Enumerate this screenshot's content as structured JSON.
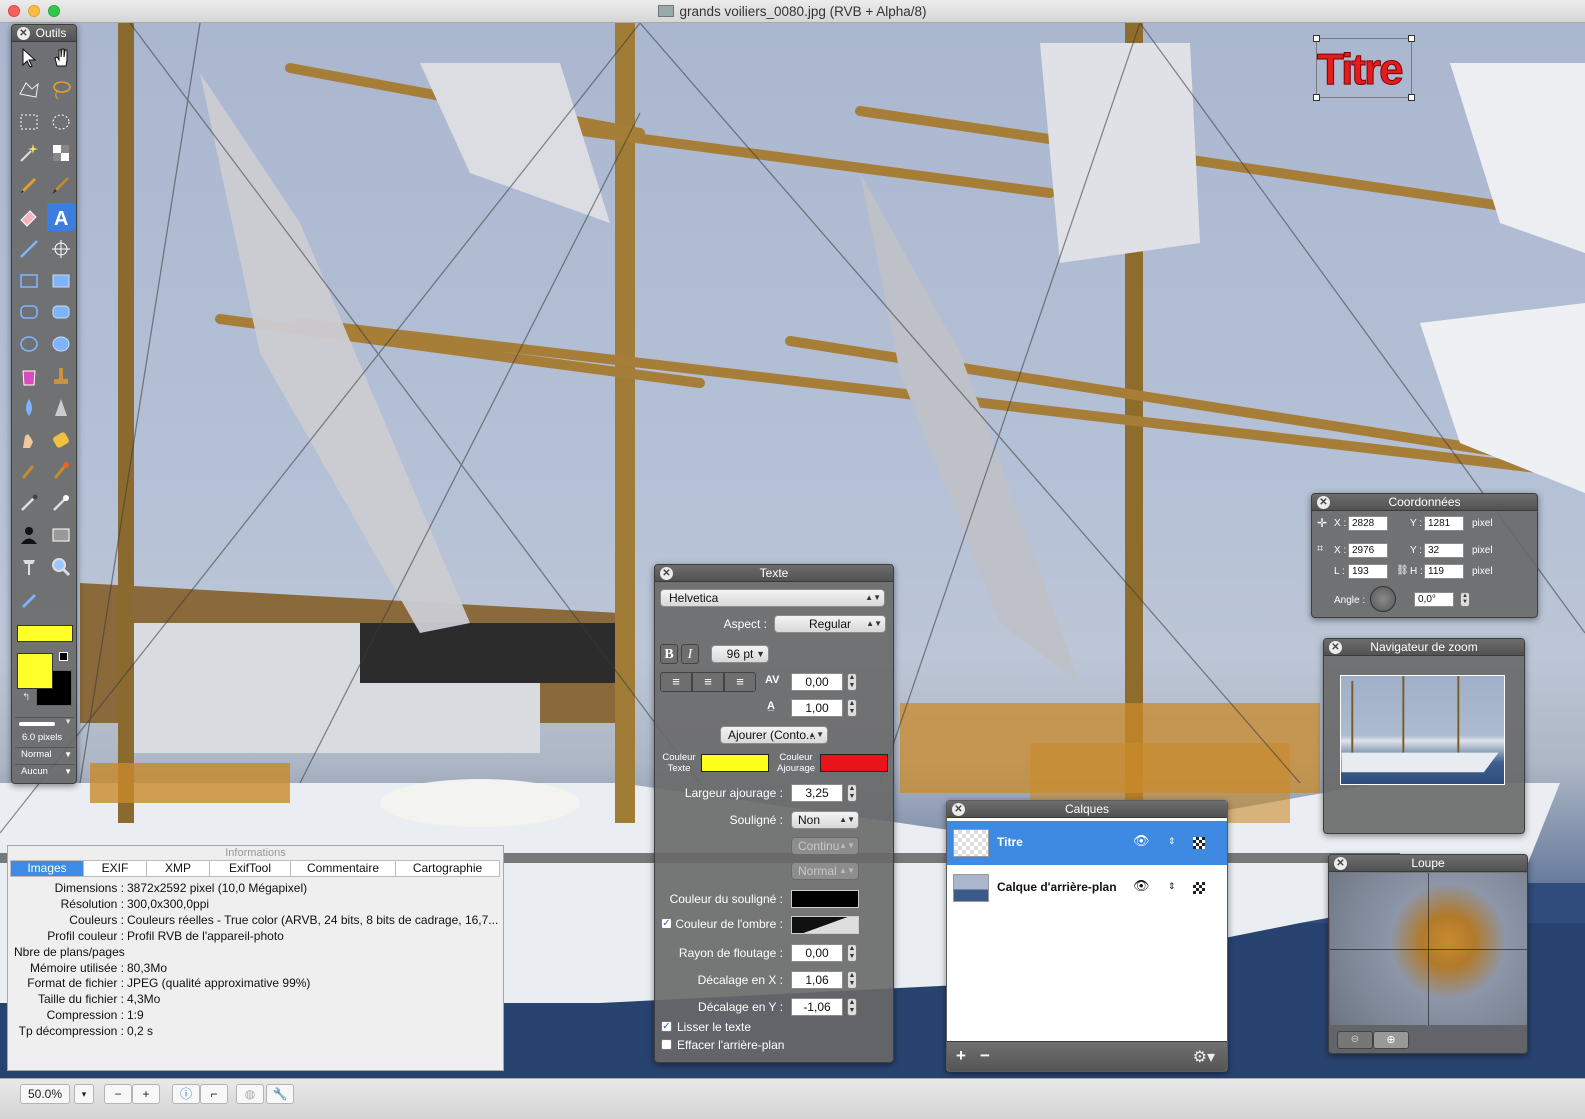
{
  "window": {
    "title": "grands voiliers_0080.jpg (RVB + Alpha/8)"
  },
  "canvas": {
    "title_text": "Titre",
    "title_color": "#e41c1c"
  },
  "tools_panel": {
    "title": "Outils",
    "tools": [
      "arrow-select",
      "hand",
      "polygon-lasso",
      "lasso",
      "rect-select",
      "ellipse-select",
      "magic-wand",
      "select-color",
      "pencil",
      "brush",
      "eraser",
      "text",
      "line",
      "crosshair",
      "rect",
      "filled-rect",
      "round-rect",
      "filled-round-rect",
      "ellipse",
      "filled-ellipse",
      "paint-bucket",
      "stamp",
      "drop",
      "cone",
      "smudge",
      "sponge",
      "dodge",
      "burn",
      "eyedropper",
      "clone",
      "silhouette",
      "pattern",
      "pin",
      "zoom",
      "gradient"
    ],
    "selected_tool": "text",
    "fg_color": "#ffff2a",
    "bg_color": "#000000",
    "brush_size": "6.0 pixels",
    "blend_mode": "Normal",
    "fill_mode": "Aucun"
  },
  "text_panel": {
    "title": "Texte",
    "font": "Helvetica",
    "aspect_label": "Aspect :",
    "aspect_value": "Regular",
    "bold": "B",
    "italic": "I",
    "size": "96 pt",
    "kerning": "0,00",
    "leading": "1,00",
    "outline_mode": "Ajourer (Conto...",
    "text_color_label_1": "Couleur",
    "text_color_label_2": "Texte",
    "outline_color_label_1": "Couleur",
    "outline_color_label_2": "Ajourage",
    "text_color": "#ffff1e",
    "outline_color": "#e8141a",
    "outline_width_label": "Largeur ajourage :",
    "outline_width": "3,25",
    "underline_label": "Souligné :",
    "underline_value": "Non",
    "underline_style": "Continu",
    "underline_mode": "Normal",
    "underline_color_label": "Couleur du souligné :",
    "shadow_label": "Couleur de l'ombre :",
    "blur_label": "Rayon de floutage :",
    "blur_value": "0,00",
    "offset_x_label": "Décalage en X :",
    "offset_x": "1,06",
    "offset_y_label": "Décalage en Y :",
    "offset_y": "-1,06",
    "smooth_label": "Lisser le texte",
    "erase_bg_label": "Effacer l'arrière-plan"
  },
  "coords_panel": {
    "title": "Coordonnées",
    "cursor_x": "2828",
    "cursor_y": "1281",
    "sel_x": "2976",
    "sel_y": "32",
    "width": "193",
    "height": "119",
    "angle_label": "Angle :",
    "angle": "0,0°",
    "unit": "pixel",
    "x_label": "X :",
    "y_label": "Y :",
    "l_label": "L :",
    "h_label": "H :"
  },
  "zoom_nav": {
    "title": "Navigateur de zoom"
  },
  "loupe": {
    "title": "Loupe"
  },
  "layers_panel": {
    "title": "Calques",
    "layers": [
      {
        "name": "Titre",
        "selected": true
      },
      {
        "name": "Calque d'arrière-plan",
        "selected": false
      }
    ],
    "add": "+",
    "remove": "−"
  },
  "info_panel": {
    "title": "Informations",
    "tabs": [
      "Images",
      "EXIF",
      "XMP",
      "ExifTool",
      "Commentaire",
      "Cartographie"
    ],
    "active_tab": "Images",
    "rows": [
      {
        "k": "Dimensions :",
        "v": "3872x2592 pixel (10,0 Mégapixel)"
      },
      {
        "k": "Résolution :",
        "v": "300,0x300,0ppi"
      },
      {
        "k": "Couleurs :",
        "v": "Couleurs réelles - True color (ARVB, 24 bits, 8 bits de cadrage, 16,7..."
      },
      {
        "k": "Profil couleur :",
        "v": "Profil RVB de l'appareil-photo"
      },
      {
        "k": "Nbre de plans/pages",
        "v": ""
      },
      {
        "k": "Mémoire utilisée :",
        "v": "80,3Mo"
      },
      {
        "k": "Format de fichier :",
        "v": "JPEG (qualité approximative 99%)"
      },
      {
        "k": "Taille du fichier :",
        "v": "4,3Mo"
      },
      {
        "k": "Compression :",
        "v": "1:9"
      },
      {
        "k": "Tp décompression :",
        "v": "0,2 s"
      }
    ]
  },
  "status_bar": {
    "zoom": "50.0%",
    "zoom_out": "−",
    "zoom_in": "+"
  }
}
